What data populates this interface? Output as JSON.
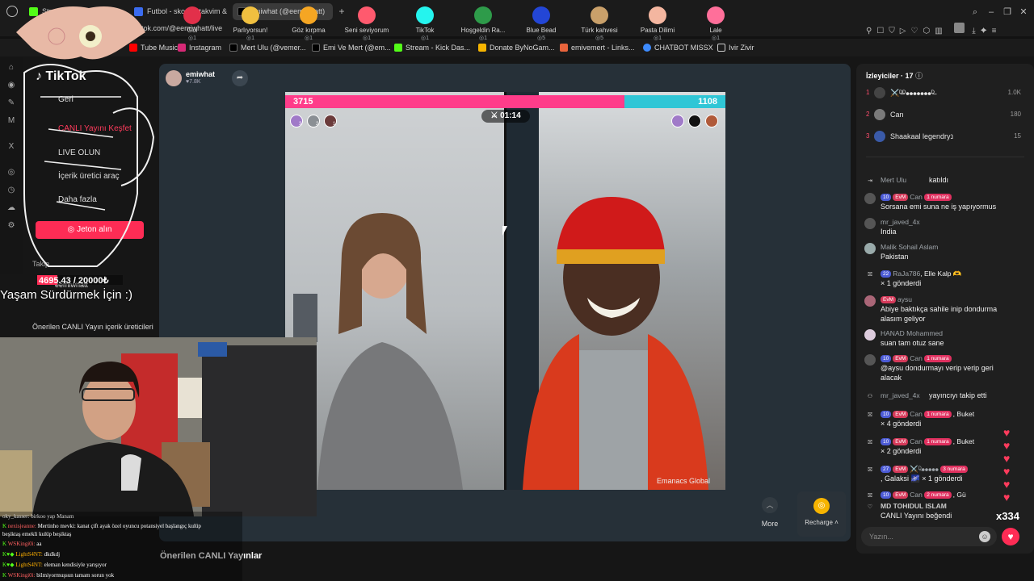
{
  "browser": {
    "tabs": [
      {
        "label": "Stre",
        "color": "#53fc18"
      },
      {
        "label": "Futbol - skorlar, takvim & t",
        "color": "#3b6cf0"
      },
      {
        "label": "emiwhat (@eemiwhatt)",
        "color": "#000000"
      }
    ],
    "url": "tiktok.com/@eemiwhatt/live",
    "bookmarks": [
      {
        "label": "Tube Music",
        "color": "#ff0000"
      },
      {
        "label": "Instagram",
        "color": "#d62976"
      },
      {
        "label": "Mert Ulu (@vemer...",
        "color": "#000000"
      },
      {
        "label": "Emi Ve Mert (@em...",
        "color": "#000000"
      },
      {
        "label": "Stream - Kick Das...",
        "color": "#53fc18"
      },
      {
        "label": "Donate ByNoGam...",
        "color": "#f5b400"
      },
      {
        "label": "emivemert - Links...",
        "color": "#e8643c"
      },
      {
        "label": "CHATBOT MISSX",
        "color": "#3d8bff"
      },
      {
        "label": "Ivir Zivir",
        "color": "#cccccc"
      }
    ]
  },
  "sidebar": {
    "brand": "TikTok",
    "back": "Geri",
    "items": [
      "CANLI Yayını Keşfet",
      "LIVE OLUN",
      "İçerik üretici araç",
      "Daha fazla"
    ],
    "coin_button": "Jeton alın",
    "following_label": "Takip ...",
    "following_user": "eemiwhatt",
    "suggested_label": "Önerilen CANLI Yayın içerik üreticileri"
  },
  "overlay": {
    "donation_progress": "4695.43 / 20000₺",
    "donation_fraction": 0.2348,
    "slogan": "Yaşam Sürdürmek İçin :)"
  },
  "stream": {
    "host_name": "emiwhat",
    "host_followers": "7.8K",
    "score_left": "3715",
    "score_right": "1108",
    "timer": "01:14",
    "avatar_counts": [
      "3",
      "2",
      "1"
    ],
    "watermark": "Emanacs Global"
  },
  "gifts": [
    {
      "name": "Gül",
      "price": "1",
      "color": "#e2304a"
    },
    {
      "name": "Parlıyorsun!",
      "price": "1",
      "color": "#f0c040"
    },
    {
      "name": "Göz kırpma",
      "price": "1",
      "color": "#f5a623"
    },
    {
      "name": "Seni seviyorum",
      "price": "1",
      "color": "#ff5a6e"
    },
    {
      "name": "TikTok",
      "price": "1",
      "color": "#25f4ee"
    },
    {
      "name": "Hoşgeldin Ra...",
      "price": "1",
      "color": "#2e9b4a"
    },
    {
      "name": "Blue Bead",
      "price": "5",
      "color": "#2346d6"
    },
    {
      "name": "Türk kahvesi",
      "price": "5",
      "color": "#c9a06a"
    },
    {
      "name": "Pasta Dilimi",
      "price": "1",
      "color": "#f4b6a0"
    },
    {
      "name": "Lale",
      "price": "1",
      "color": "#ff6f9a"
    }
  ],
  "gift_controls": {
    "more": "More",
    "recharge": "Recharge"
  },
  "recommend_heading": "Önerilen CANLI Yayınlar",
  "viewers": {
    "title": "İzleyiciler · 17",
    "list": [
      {
        "rank": "1",
        "name": "⚔️ᴰ̶̶̶ᴰ⦁⦁⦁⦁⦁⦁⦁ᴰ̶̶",
        "score": "1.0K"
      },
      {
        "rank": "2",
        "name": "Can",
        "score": "180"
      },
      {
        "rank": "3",
        "name": "Shaakaal legendryנ",
        "score": "15"
      }
    ]
  },
  "chat": [
    {
      "user": "Mert Ulu",
      "msg": "katıldı",
      "inline": true,
      "badges": []
    },
    {
      "user": "Can",
      "msg": "Sorsana emi suna ne iş yapıyormus",
      "badges": [
        "10",
        "EvM",
        "1 numara"
      ]
    },
    {
      "user": "mr_javed_4x",
      "msg": "India",
      "badges": []
    },
    {
      "user": "Malik Sohail Aslam",
      "msg": "Pakistan",
      "badges": []
    },
    {
      "user": "RaJa786",
      "msg": ", Elle Kalp 🫶",
      "extra": "× 1 gönderdi",
      "badges": [
        "22"
      ]
    },
    {
      "user": "aysu",
      "msg": "Abiye baktıkça sahile inip dondurma",
      "extra": "alasım geliyor",
      "badges": [
        "EvM"
      ]
    },
    {
      "user": "HANAD Mohammed",
      "msg": "suan tam otuz sane",
      "badges": []
    },
    {
      "user": "Can",
      "msg": "@aysu dondurmayı verip verip geri",
      "extra": "alacak",
      "badges": [
        "10",
        "EvM",
        "1 numara"
      ]
    },
    {
      "user": "mr_javed_4x",
      "msg": "yayıncıyı takip etti",
      "inline": true,
      "badges": []
    },
    {
      "user": "Can",
      "msg": ", Buket",
      "extra": "× 4 gönderdi",
      "badges": [
        "10",
        "EvM",
        "1 numara"
      ]
    },
    {
      "user": "Can",
      "msg": ", Buket",
      "extra": "× 2 gönderdi",
      "badges": [
        "10",
        "EvM",
        "1 numara"
      ]
    },
    {
      "user": "⚔️ᴰ̶̶̶⦁⦁⦁⦁⦁",
      "msg": ", Galaksi 🌌 × 1 gönderdi",
      "badges": [
        "27",
        "EvM",
        "3 numara"
      ]
    },
    {
      "user": "Can",
      "msg": ", Gü",
      "badges": [
        "10",
        "EvM",
        "2 numara"
      ]
    },
    {
      "user": "MD TOHIDUL ISLAM",
      "msg": "CANLI Yayını beğendi",
      "badges": []
    }
  ],
  "like_count": "x334",
  "chat_placeholder": "Yazın...",
  "overlay_chat": [
    {
      "user": "oky_kasser:",
      "msg": "birkoo yap Manam",
      "color": "#d0d0d0"
    },
    {
      "user": "nexisjeanne:",
      "msg": "Mertinho mevki: kanat çift ayak özel oyuncu potansiyel başlangıç kulüp",
      "color": "#ff6060"
    },
    {
      "user": "",
      "msg": "beşiktaş emekli kulüp beşiktaş",
      "color": "#ffffff"
    },
    {
      "user": "WSKingi0i:",
      "msg": "aa",
      "color": "#ff6060"
    },
    {
      "user": "LightS4NT:",
      "msg": "dkdkdj",
      "color": "#ffb000"
    },
    {
      "user": "LightS4NT:",
      "msg": "eleman kendisiyle yarışıyor",
      "color": "#ffb000"
    },
    {
      "user": "WSKingi0i:",
      "msg": "bilmiyormuşsun tamam sorun yok",
      "color": "#ff6060"
    }
  ]
}
